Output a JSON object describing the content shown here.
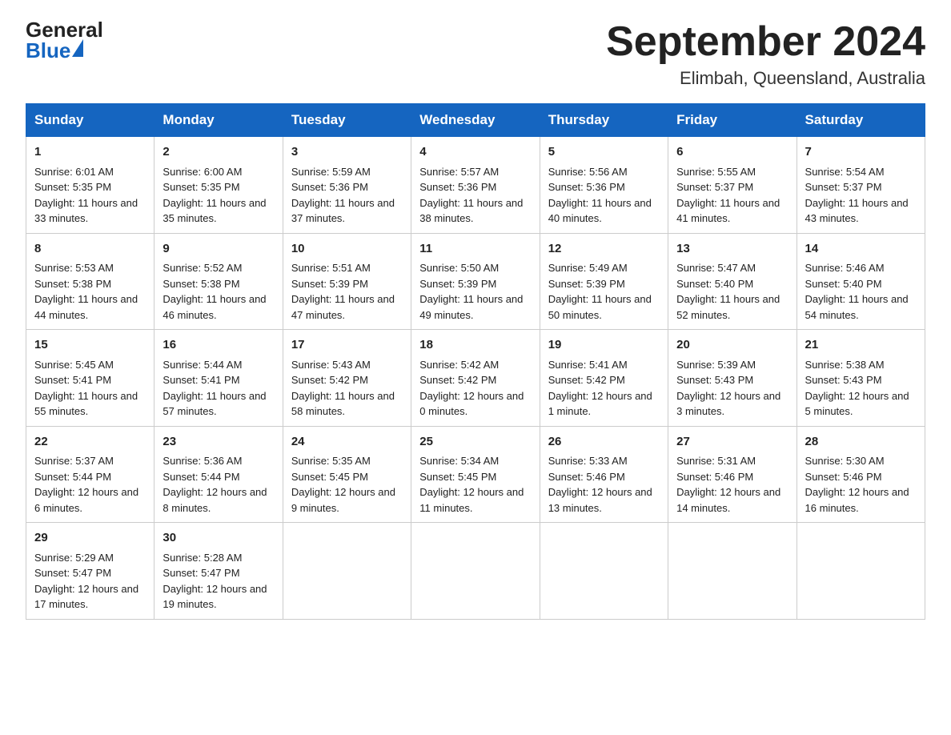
{
  "logo": {
    "text_general": "General",
    "text_blue": "Blue",
    "triangle_visible": true
  },
  "title": "September 2024",
  "subtitle": "Elimbah, Queensland, Australia",
  "days_of_week": [
    "Sunday",
    "Monday",
    "Tuesday",
    "Wednesday",
    "Thursday",
    "Friday",
    "Saturday"
  ],
  "weeks": [
    [
      {
        "day": "1",
        "sunrise": "Sunrise: 6:01 AM",
        "sunset": "Sunset: 5:35 PM",
        "daylight": "Daylight: 11 hours and 33 minutes."
      },
      {
        "day": "2",
        "sunrise": "Sunrise: 6:00 AM",
        "sunset": "Sunset: 5:35 PM",
        "daylight": "Daylight: 11 hours and 35 minutes."
      },
      {
        "day": "3",
        "sunrise": "Sunrise: 5:59 AM",
        "sunset": "Sunset: 5:36 PM",
        "daylight": "Daylight: 11 hours and 37 minutes."
      },
      {
        "day": "4",
        "sunrise": "Sunrise: 5:57 AM",
        "sunset": "Sunset: 5:36 PM",
        "daylight": "Daylight: 11 hours and 38 minutes."
      },
      {
        "day": "5",
        "sunrise": "Sunrise: 5:56 AM",
        "sunset": "Sunset: 5:36 PM",
        "daylight": "Daylight: 11 hours and 40 minutes."
      },
      {
        "day": "6",
        "sunrise": "Sunrise: 5:55 AM",
        "sunset": "Sunset: 5:37 PM",
        "daylight": "Daylight: 11 hours and 41 minutes."
      },
      {
        "day": "7",
        "sunrise": "Sunrise: 5:54 AM",
        "sunset": "Sunset: 5:37 PM",
        "daylight": "Daylight: 11 hours and 43 minutes."
      }
    ],
    [
      {
        "day": "8",
        "sunrise": "Sunrise: 5:53 AM",
        "sunset": "Sunset: 5:38 PM",
        "daylight": "Daylight: 11 hours and 44 minutes."
      },
      {
        "day": "9",
        "sunrise": "Sunrise: 5:52 AM",
        "sunset": "Sunset: 5:38 PM",
        "daylight": "Daylight: 11 hours and 46 minutes."
      },
      {
        "day": "10",
        "sunrise": "Sunrise: 5:51 AM",
        "sunset": "Sunset: 5:39 PM",
        "daylight": "Daylight: 11 hours and 47 minutes."
      },
      {
        "day": "11",
        "sunrise": "Sunrise: 5:50 AM",
        "sunset": "Sunset: 5:39 PM",
        "daylight": "Daylight: 11 hours and 49 minutes."
      },
      {
        "day": "12",
        "sunrise": "Sunrise: 5:49 AM",
        "sunset": "Sunset: 5:39 PM",
        "daylight": "Daylight: 11 hours and 50 minutes."
      },
      {
        "day": "13",
        "sunrise": "Sunrise: 5:47 AM",
        "sunset": "Sunset: 5:40 PM",
        "daylight": "Daylight: 11 hours and 52 minutes."
      },
      {
        "day": "14",
        "sunrise": "Sunrise: 5:46 AM",
        "sunset": "Sunset: 5:40 PM",
        "daylight": "Daylight: 11 hours and 54 minutes."
      }
    ],
    [
      {
        "day": "15",
        "sunrise": "Sunrise: 5:45 AM",
        "sunset": "Sunset: 5:41 PM",
        "daylight": "Daylight: 11 hours and 55 minutes."
      },
      {
        "day": "16",
        "sunrise": "Sunrise: 5:44 AM",
        "sunset": "Sunset: 5:41 PM",
        "daylight": "Daylight: 11 hours and 57 minutes."
      },
      {
        "day": "17",
        "sunrise": "Sunrise: 5:43 AM",
        "sunset": "Sunset: 5:42 PM",
        "daylight": "Daylight: 11 hours and 58 minutes."
      },
      {
        "day": "18",
        "sunrise": "Sunrise: 5:42 AM",
        "sunset": "Sunset: 5:42 PM",
        "daylight": "Daylight: 12 hours and 0 minutes."
      },
      {
        "day": "19",
        "sunrise": "Sunrise: 5:41 AM",
        "sunset": "Sunset: 5:42 PM",
        "daylight": "Daylight: 12 hours and 1 minute."
      },
      {
        "day": "20",
        "sunrise": "Sunrise: 5:39 AM",
        "sunset": "Sunset: 5:43 PM",
        "daylight": "Daylight: 12 hours and 3 minutes."
      },
      {
        "day": "21",
        "sunrise": "Sunrise: 5:38 AM",
        "sunset": "Sunset: 5:43 PM",
        "daylight": "Daylight: 12 hours and 5 minutes."
      }
    ],
    [
      {
        "day": "22",
        "sunrise": "Sunrise: 5:37 AM",
        "sunset": "Sunset: 5:44 PM",
        "daylight": "Daylight: 12 hours and 6 minutes."
      },
      {
        "day": "23",
        "sunrise": "Sunrise: 5:36 AM",
        "sunset": "Sunset: 5:44 PM",
        "daylight": "Daylight: 12 hours and 8 minutes."
      },
      {
        "day": "24",
        "sunrise": "Sunrise: 5:35 AM",
        "sunset": "Sunset: 5:45 PM",
        "daylight": "Daylight: 12 hours and 9 minutes."
      },
      {
        "day": "25",
        "sunrise": "Sunrise: 5:34 AM",
        "sunset": "Sunset: 5:45 PM",
        "daylight": "Daylight: 12 hours and 11 minutes."
      },
      {
        "day": "26",
        "sunrise": "Sunrise: 5:33 AM",
        "sunset": "Sunset: 5:46 PM",
        "daylight": "Daylight: 12 hours and 13 minutes."
      },
      {
        "day": "27",
        "sunrise": "Sunrise: 5:31 AM",
        "sunset": "Sunset: 5:46 PM",
        "daylight": "Daylight: 12 hours and 14 minutes."
      },
      {
        "day": "28",
        "sunrise": "Sunrise: 5:30 AM",
        "sunset": "Sunset: 5:46 PM",
        "daylight": "Daylight: 12 hours and 16 minutes."
      }
    ],
    [
      {
        "day": "29",
        "sunrise": "Sunrise: 5:29 AM",
        "sunset": "Sunset: 5:47 PM",
        "daylight": "Daylight: 12 hours and 17 minutes."
      },
      {
        "day": "30",
        "sunrise": "Sunrise: 5:28 AM",
        "sunset": "Sunset: 5:47 PM",
        "daylight": "Daylight: 12 hours and 19 minutes."
      },
      null,
      null,
      null,
      null,
      null
    ]
  ]
}
